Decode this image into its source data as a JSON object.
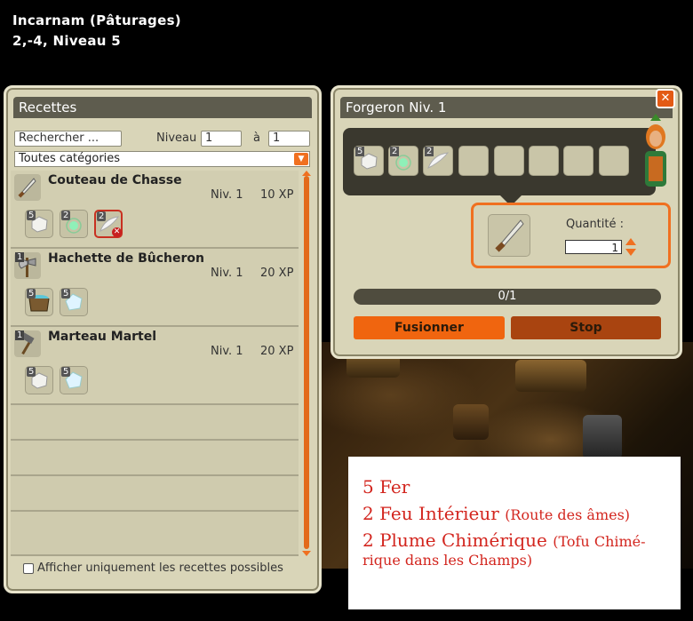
{
  "location": {
    "line1": "Incarnam (Pâturages)",
    "line2": "2,-4, Niveau 5"
  },
  "recettes": {
    "title": "Recettes",
    "search_placeholder": "Rechercher ...",
    "niveau_label": "Niveau",
    "niveau_min": "1",
    "a_label": "à",
    "niveau_max": "1",
    "category": "Toutes catégories",
    "only_possible_label": "Afficher uniquement les recettes possibles",
    "items": [
      {
        "name": "Couteau de Chasse",
        "level": "Niv. 1",
        "xp": "10 XP",
        "icon": "dagger-icon",
        "count": "",
        "ingredients": [
          {
            "qty": "5",
            "icon": "iron-ore-icon"
          },
          {
            "qty": "2",
            "icon": "inner-fire-icon"
          },
          {
            "qty": "2",
            "icon": "feather-icon",
            "missing": true
          }
        ]
      },
      {
        "name": "Hachette de Bûcheron",
        "level": "Niv. 1",
        "xp": "20 XP",
        "icon": "hatchet-icon",
        "count": "1",
        "ingredients": [
          {
            "qty": "5",
            "icon": "bucket-icon"
          },
          {
            "qty": "5",
            "icon": "crystal-icon"
          }
        ]
      },
      {
        "name": "Marteau Martel",
        "level": "Niv. 1",
        "xp": "20 XP",
        "icon": "hammer-icon",
        "count": "1",
        "ingredients": [
          {
            "qty": "5",
            "icon": "iron-ore-icon"
          },
          {
            "qty": "5",
            "icon": "crystal-icon"
          }
        ]
      }
    ]
  },
  "forgeron": {
    "title": "Forgeron Niv. 1",
    "slots": [
      {
        "qty": "5",
        "icon": "iron-ore-icon"
      },
      {
        "qty": "2",
        "icon": "inner-fire-icon"
      },
      {
        "qty": "2",
        "icon": "feather-icon"
      }
    ],
    "quantite_label": "Quantité :",
    "quantite_value": "1",
    "progress_text": "0/1",
    "progress_value": 0,
    "fuse_label": "Fusionner",
    "stop_label": "Stop"
  },
  "note": {
    "line1": "5 Fer",
    "line2_main": "2 Feu Intérieur",
    "line2_sub": "(Route des âmes)",
    "line3_main": "2 Plume Chimérique",
    "line3_sub": "(Tofu Chimé-",
    "line4": "rique dans les Champs)"
  },
  "colors": {
    "accent": "#f07020",
    "panel": "#d9d5b8",
    "title_bar": "#5e5c4e",
    "note_text": "#d3261f"
  }
}
